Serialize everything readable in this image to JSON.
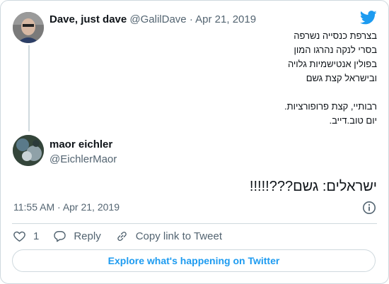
{
  "original_tweet": {
    "display_name": "Dave, just dave",
    "handle": "@GalilDave",
    "separator": "·",
    "date": "Apr 21, 2019",
    "lines": [
      "בצרפת כנסייה נשרפה",
      "בסרי לנקה נהרגו המון",
      "בפולין אנטישמיות גלויה",
      "ובישראל קצת גשם",
      "",
      "רבותיי, קצת פרופורציות.",
      "יום טוב.דייב."
    ]
  },
  "reply_tweet": {
    "display_name": "maor eichler",
    "handle": "@EichlerMaor",
    "text": "ישראלים: גשם???!!!!!",
    "time": "11:55 AM",
    "separator": "·",
    "date": "Apr 21, 2019"
  },
  "actions": {
    "like_count": "1",
    "reply_label": "Reply",
    "copy_link_label": "Copy link to Tweet"
  },
  "explore_button": {
    "label": "Explore what's happening on Twitter"
  },
  "icons": {
    "brand": "twitter-bird-icon",
    "info": "info-icon",
    "like": "heart-icon",
    "reply": "reply-bubble-icon",
    "copy_link": "link-icon"
  },
  "colors": {
    "accent": "#1d9bf0",
    "text": "#0f1419",
    "muted": "#536471",
    "border": "#cfd9de"
  }
}
